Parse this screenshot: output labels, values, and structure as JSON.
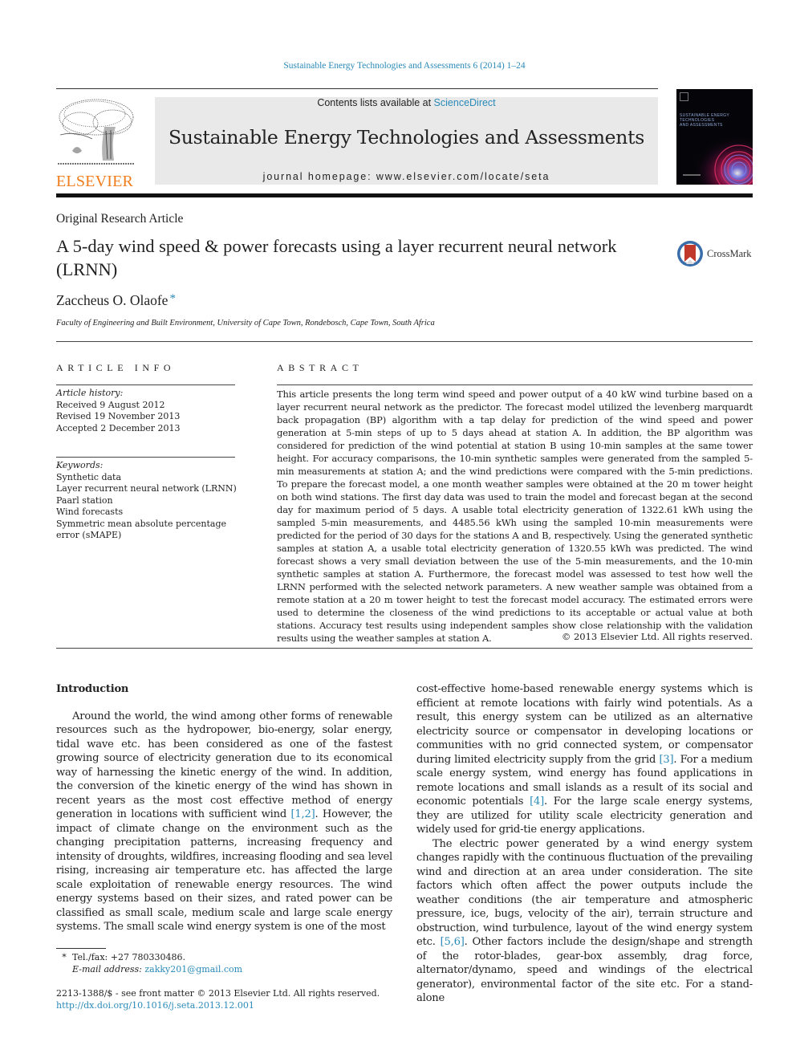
{
  "header": {
    "journal_ref": "Sustainable Energy Technologies and Assessments 6 (2014) 1–24",
    "contents_prefix": "Contents lists available at ",
    "contents_link": "ScienceDirect",
    "journal_title": "Sustainable Energy Technologies and Assessments",
    "homepage_prefix": "journal homepage: ",
    "homepage_url": "www.elsevier.com/locate/seta",
    "publisher_logo_text": "ELSEVIER",
    "cover_text_lines": [
      "SUSTAINABLE ENERGY",
      "TECHNOLOGIES",
      "AND ASSESSMENTS"
    ],
    "brand_color": "#f07d1c",
    "link_color": "#2a8ab8"
  },
  "article": {
    "type": "Original Research Article",
    "title": "A 5-day wind speed & power forecasts using a layer recurrent neural network (LRNN)",
    "crossmark_label": "CrossMark",
    "author": "Zaccheus O. Olaofe",
    "author_marker": "*",
    "affiliation": "Faculty of Engineering and Built Environment, University of Cape Town, Rondebosch, Cape Town, South Africa"
  },
  "article_info": {
    "heading": "ARTICLE INFO",
    "history_label": "Article history:",
    "history": [
      "Received 9 August 2012",
      "Revised 19 November 2013",
      "Accepted 2 December 2013"
    ],
    "keywords_label": "Keywords:",
    "keywords": [
      "Synthetic data",
      "Layer recurrent neural network (LRNN)",
      "Paarl station",
      "Wind forecasts",
      "Symmetric mean absolute percentage error (sMAPE)"
    ]
  },
  "abstract": {
    "heading": "ABSTRACT",
    "text": "This article presents the long term wind speed and power output of a 40 kW wind turbine based on a layer recurrent neural network as the predictor. The forecast model utilized the levenberg marquardt back propagation (BP) algorithm with a tap delay for prediction of the wind speed and power generation at 5-min steps of up to 5 days ahead at station A. In addition, the BP algorithm was considered for prediction of the wind potential at station B using 10-min samples at the same tower height. For accuracy comparisons, the 10-min synthetic samples were generated from the sampled 5-min measurements at station A; and the wind predictions were compared with the 5-min predictions. To prepare the forecast model, a one month weather samples were obtained at the 20 m tower height on both wind stations. The first day data was used to train the model and forecast began at the second day for maximum period of 5 days. A usable total electricity generation of 1322.61 kWh using the sampled 5-min measurements, and 4485.56 kWh using the sampled 10-min measurements were predicted for the period of 30 days for the stations A and B, respectively. Using the generated synthetic samples at station A, a usable total electricity generation of 1320.55 kWh was predicted. The wind forecast shows a very small deviation between the use of the 5-min measurements, and the 10-min synthetic samples at station A. Furthermore, the forecast model was assessed to test how well the LRNN performed with the selected network parameters. A new weather sample was obtained from a remote station at a 20 m tower height to test the forecast model accuracy. The estimated errors were used to determine the closeness of the wind predictions to its acceptable or actual value at both stations. Accuracy test results using independent samples show close relationship with the validation results using the weather samples at station A.",
    "copyright": "© 2013 Elsevier Ltd. All rights reserved."
  },
  "body": {
    "intro_heading": "Introduction",
    "left_p1_a": "Around the world, the wind among other forms of renewable resources such as the hydropower, bio-energy, solar energy, tidal wave etc. has been considered as one of the fastest growing source of electricity generation due to its economical way of harnessing the kinetic energy of the wind. In addition, the conversion of the kinetic energy of the wind has shown in recent years as the most cost effective method of energy generation in locations with sufficient wind ",
    "ref_1_2": "[1,2]",
    "left_p1_b": ". However, the impact of climate change on the environment such as the changing precipitation patterns, increasing frequency and intensity of droughts, wildfires, increasing flooding and sea level rising, increasing air temperature etc. has affected the large scale exploitation of renewable energy resources. The wind energy systems based on their sizes, and rated power can be classified as small scale, medium scale and large scale energy systems. The small scale wind energy system is one of the most",
    "right_p1_a": "cost-effective home-based renewable energy systems which is efficient at remote locations with fairly wind potentials. As a result, this energy system can be utilized as an alternative electricity source or compensator in developing locations or communities with no grid connected system, or compensator during limited electricity supply from the grid ",
    "ref_3": "[3]",
    "right_p1_b": ". For a medium scale energy system, wind energy has found applications in remote locations and small islands as a result of its social and economic potentials ",
    "ref_4": "[4]",
    "right_p1_c": ". For the large scale energy systems, they are utilized for utility scale electricity generation and widely used for grid-tie energy applications.",
    "right_p2_a": "The electric power generated by a wind energy system changes rapidly with the continuous fluctuation of the prevailing wind and direction at an area under consideration. The site factors which often affect the power outputs include the weather conditions (the air temperature and atmospheric pressure, ice, bugs, velocity of the air), terrain structure and obstruction, wind turbulence, layout of the wind energy system etc. ",
    "ref_5_6": "[5,6]",
    "right_p2_b": ". Other factors include the design/shape and strength of the rotor-blades, gear-box assembly, drag force, alternator/dynamo, speed and windings of the electrical generator), environmental factor of the site etc. For a stand-alone"
  },
  "footnote": {
    "marker": "*",
    "tel": "Tel./fax: +27 780330486.",
    "email_label": "E-mail address: ",
    "email": "zakky201@gmail.com"
  },
  "front_matter": {
    "issn_line": "2213-1388/$ - see front matter © 2013 Elsevier Ltd. All rights reserved.",
    "doi": "http://dx.doi.org/10.1016/j.seta.2013.12.001"
  }
}
